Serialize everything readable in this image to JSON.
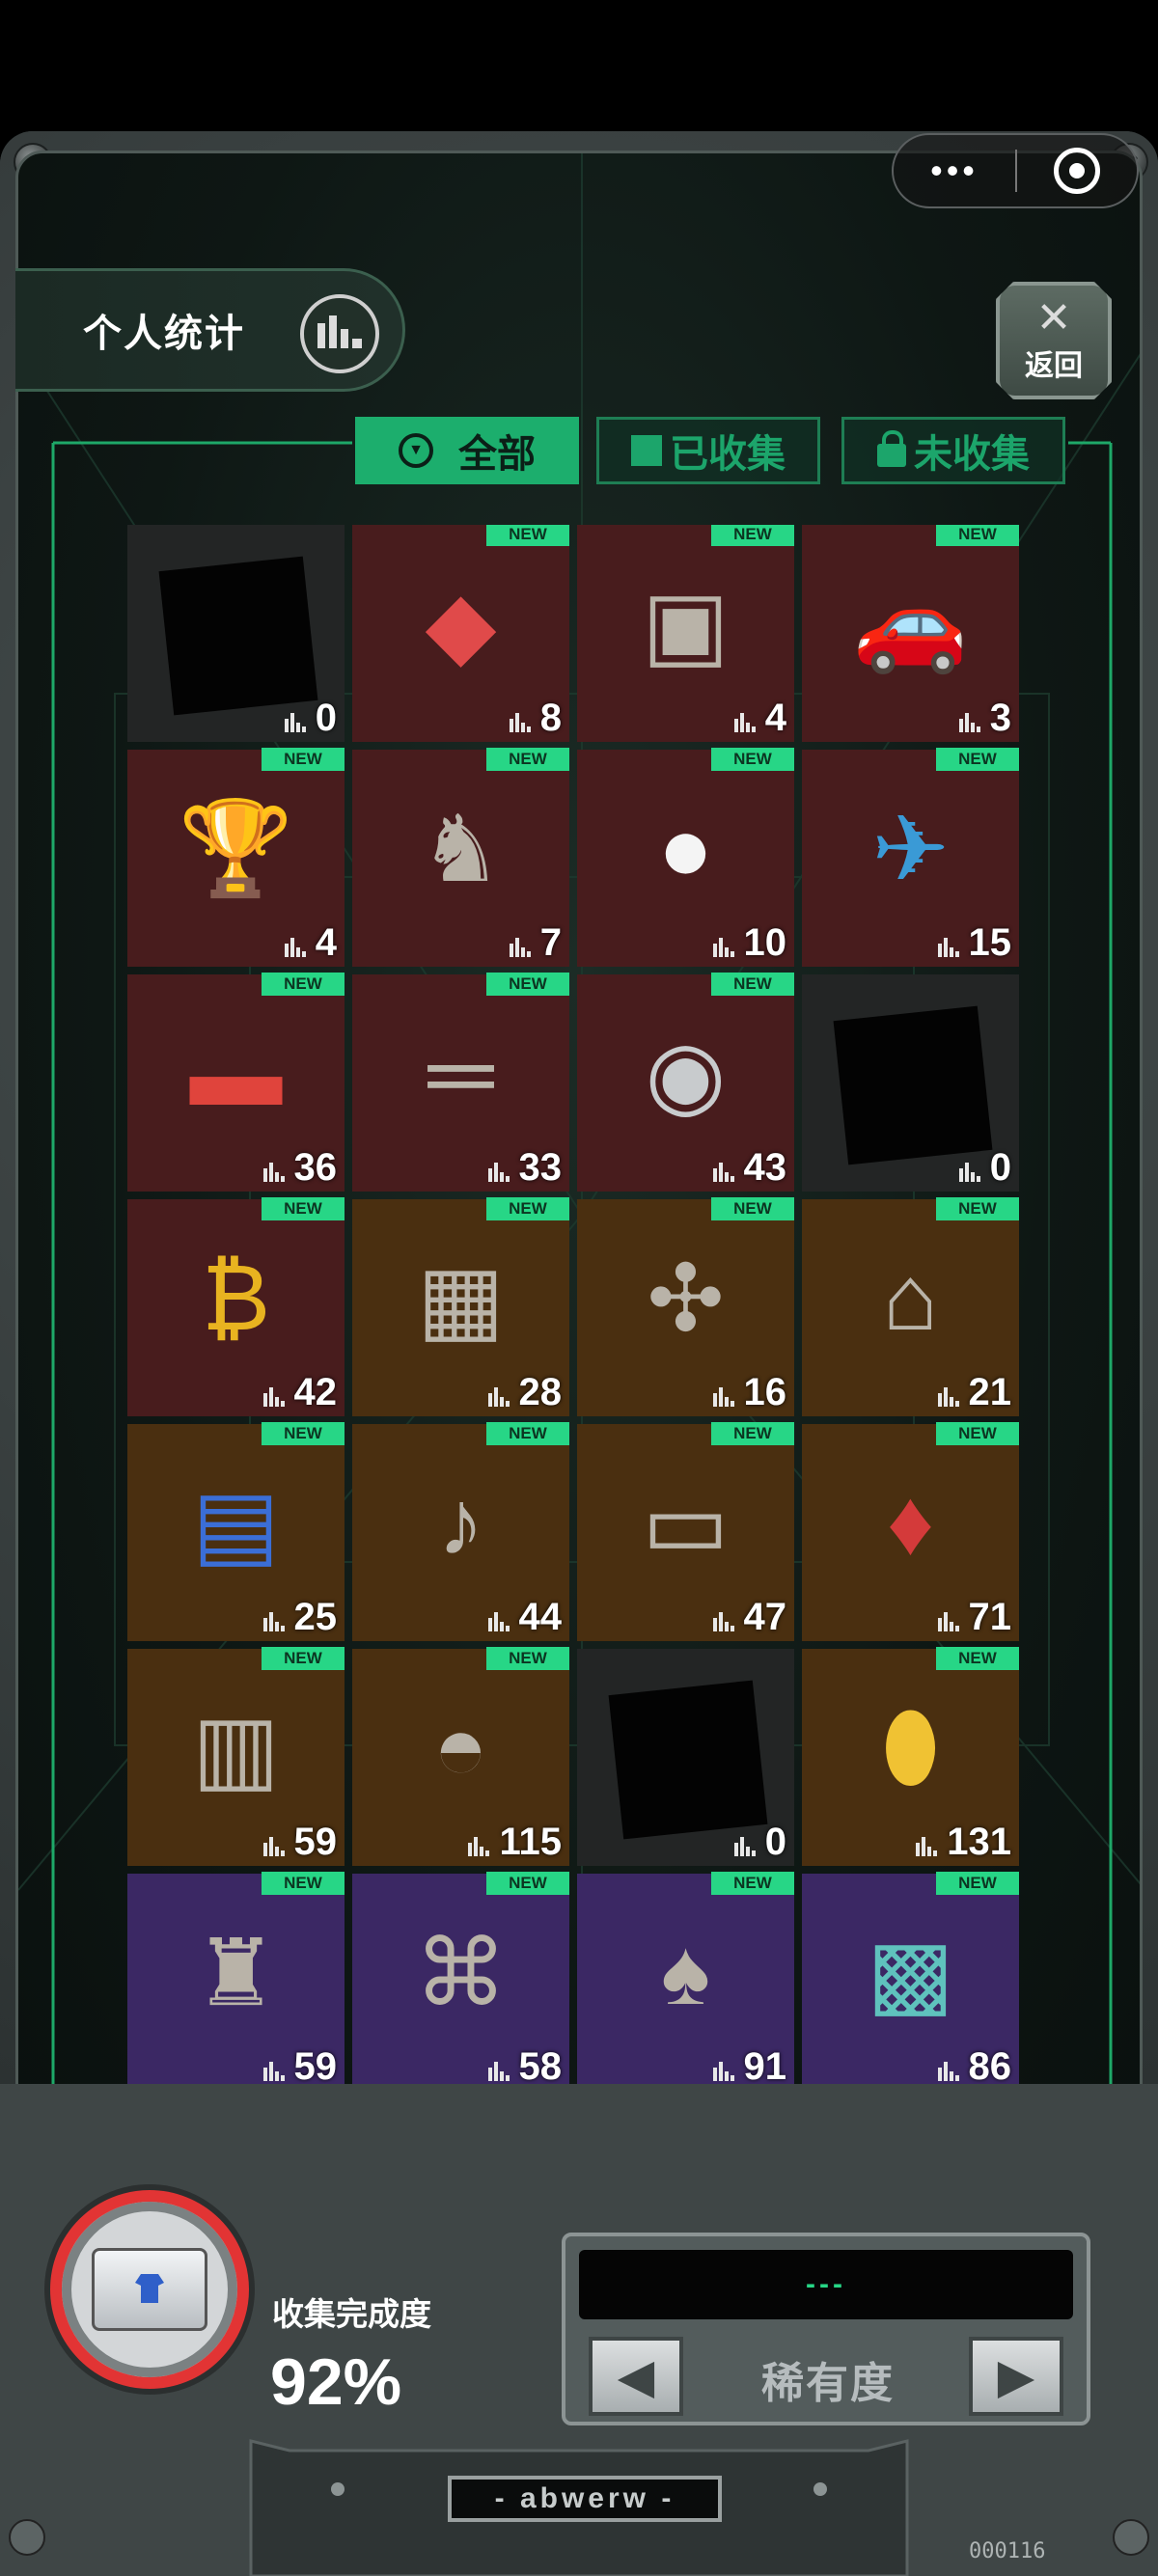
{
  "header": {
    "stats_label": "个人统计",
    "back_label": "返回",
    "back_icon": "cross-arrows-icon",
    "more_icon": "•••"
  },
  "filters": {
    "all": "全部",
    "collected": "已收集",
    "uncollected": "未收集"
  },
  "colors": {
    "accent_green": "#27d686",
    "cell_gray": "#232525",
    "cell_red": "#481c1d",
    "cell_gold": "#4a2f10",
    "cell_purple": "#3b2864"
  },
  "new_label": "NEW",
  "items": [
    {
      "count": "0",
      "new": false,
      "tier": "gray",
      "icon": "silhouette-icon"
    },
    {
      "count": "8",
      "new": true,
      "tier": "red",
      "icon": "crystal-gem-icon"
    },
    {
      "count": "4",
      "new": true,
      "tier": "red",
      "icon": "retro-tv-icon"
    },
    {
      "count": "3",
      "new": true,
      "tier": "red",
      "icon": "race-car-icon"
    },
    {
      "count": "4",
      "new": true,
      "tier": "red",
      "icon": "trophy-goblet-icon"
    },
    {
      "count": "7",
      "new": true,
      "tier": "red",
      "icon": "horse-statue-icon"
    },
    {
      "count": "10",
      "new": true,
      "tier": "red",
      "icon": "cat-mascot-icon"
    },
    {
      "count": "15",
      "new": true,
      "tier": "red",
      "icon": "spaceship-icon"
    },
    {
      "count": "36",
      "new": true,
      "tier": "red",
      "icon": "red-card-icon"
    },
    {
      "count": "33",
      "new": true,
      "tier": "red",
      "icon": "wooden-sticks-icon"
    },
    {
      "count": "43",
      "new": true,
      "tier": "red",
      "icon": "silver-coin-icon"
    },
    {
      "count": "0",
      "new": false,
      "tier": "gray",
      "icon": "silhouette-icon"
    },
    {
      "count": "42",
      "new": true,
      "tier": "red",
      "icon": "gold-bitcoin-icon"
    },
    {
      "count": "28",
      "new": true,
      "tier": "gold",
      "icon": "overalls-icon"
    },
    {
      "count": "16",
      "new": true,
      "tier": "gold",
      "icon": "drone-icon"
    },
    {
      "count": "21",
      "new": true,
      "tier": "gold",
      "icon": "robot-dog-icon"
    },
    {
      "count": "25",
      "new": true,
      "tier": "gold",
      "icon": "folded-map-icon"
    },
    {
      "count": "44",
      "new": true,
      "tier": "gold",
      "icon": "guitar-icon"
    },
    {
      "count": "47",
      "new": true,
      "tier": "gold",
      "icon": "phone-icon"
    },
    {
      "count": "71",
      "new": true,
      "tier": "gold",
      "icon": "red-pendant-icon"
    },
    {
      "count": "59",
      "new": true,
      "tier": "gold",
      "icon": "graphics-card-icon"
    },
    {
      "count": "115",
      "new": true,
      "tier": "gold",
      "icon": "helmet-icon"
    },
    {
      "count": "0",
      "new": false,
      "tier": "gray",
      "icon": "silhouette-icon"
    },
    {
      "count": "131",
      "new": true,
      "tier": "gold",
      "icon": "gold-ingot-icon"
    },
    {
      "count": "59",
      "new": true,
      "tier": "purple",
      "icon": "terracotta-warrior-icon"
    },
    {
      "count": "58",
      "new": true,
      "tier": "purple",
      "icon": "gadget-icon"
    },
    {
      "count": "91",
      "new": true,
      "tier": "purple",
      "icon": "pallbearers-icon"
    },
    {
      "count": "86",
      "new": true,
      "tier": "purple",
      "icon": "bmo-robot-icon"
    },
    {
      "count": "",
      "new": true,
      "tier": "purple",
      "icon": "item-icon"
    },
    {
      "count": "",
      "new": true,
      "tier": "purple",
      "icon": "card-icon"
    },
    {
      "count": "",
      "new": true,
      "tier": "purple",
      "icon": "item-icon"
    },
    {
      "count": "",
      "new": true,
      "tier": "purple",
      "icon": "item-icon"
    }
  ],
  "footer": {
    "completion_label": "收集完成度",
    "completion_value": "92%",
    "completion_fraction": 0.92,
    "screen_text": "---",
    "rarity_label": "稀有度",
    "nameplate": "- abwerw -",
    "serial": "000116"
  }
}
